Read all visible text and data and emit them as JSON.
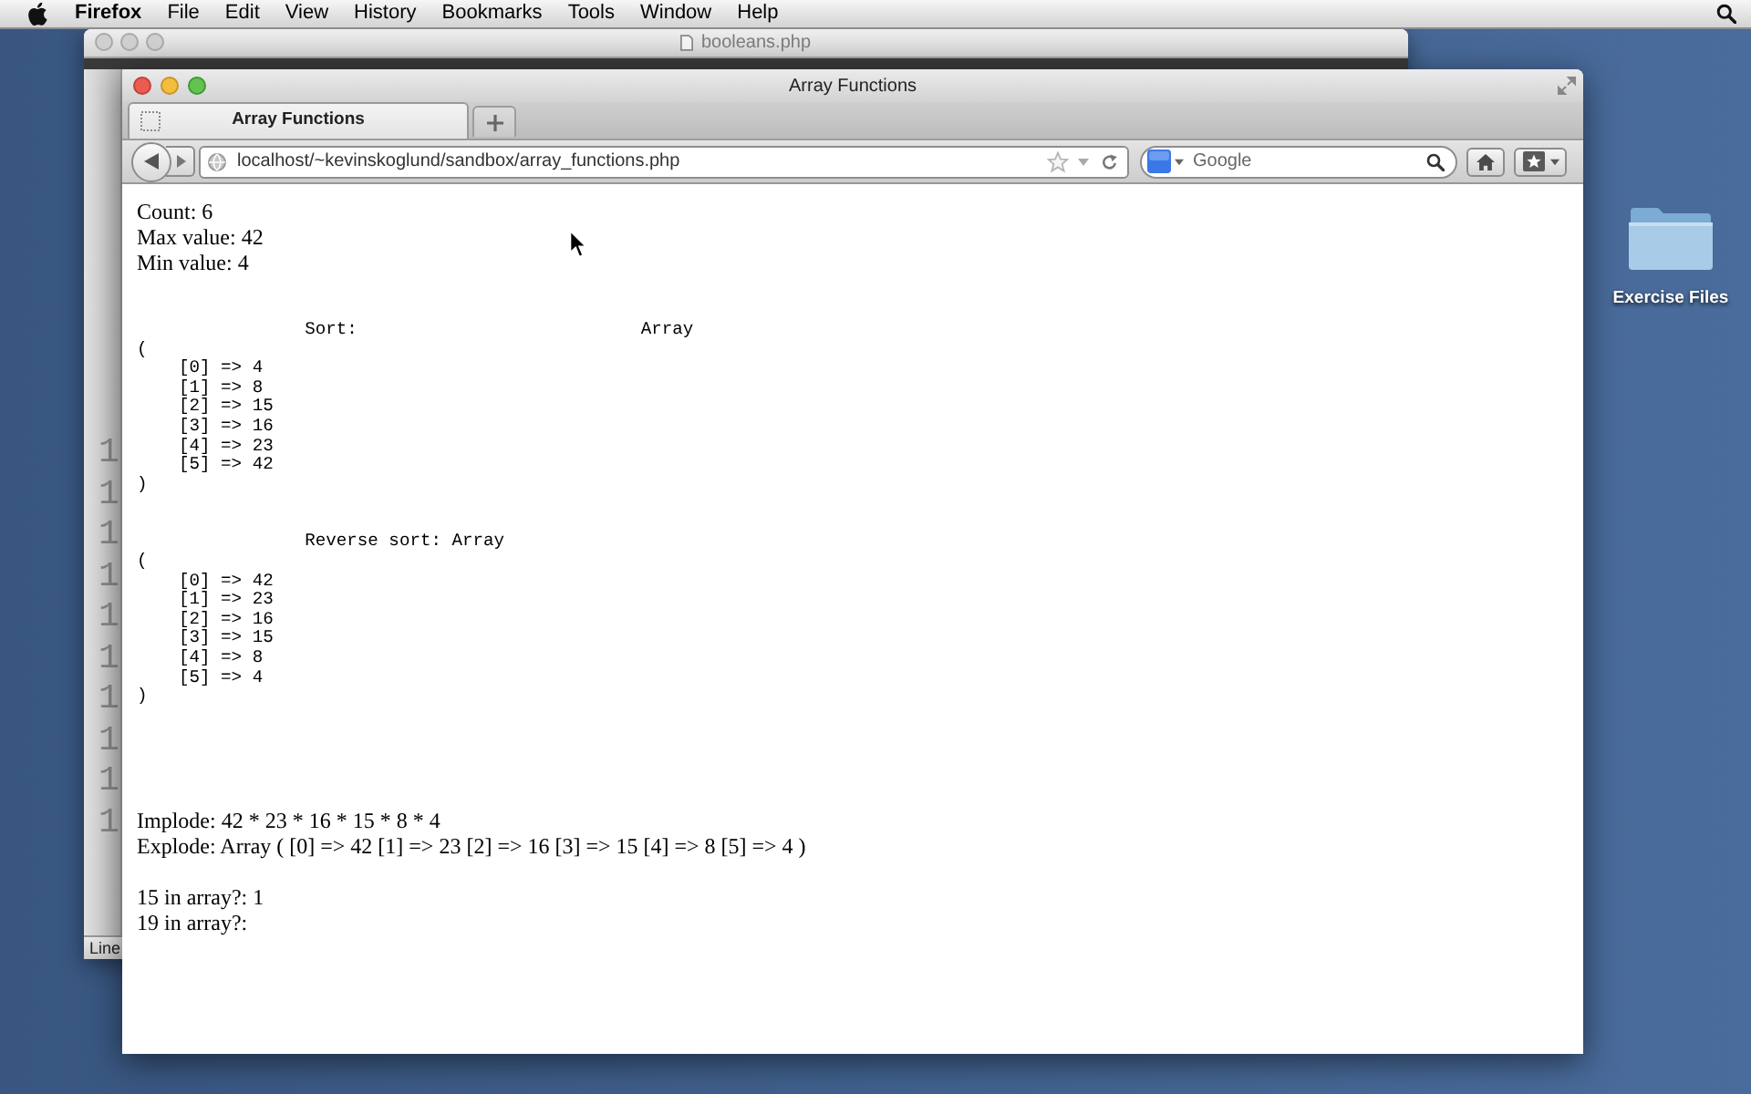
{
  "menu_bar": {
    "app_name": "Firefox",
    "menus": [
      "File",
      "Edit",
      "View",
      "History",
      "Bookmarks",
      "Tools",
      "Window",
      "Help"
    ]
  },
  "background_window": {
    "title": "booleans.php",
    "line_numbers": [
      "1",
      "1",
      "1",
      "1",
      "1",
      "1",
      "1",
      "1",
      "1",
      "1"
    ],
    "status_bar": "Line"
  },
  "browser_window": {
    "title": "Array Functions",
    "tabs": [
      {
        "label": "Array Functions",
        "selected": true
      }
    ],
    "address": "localhost/~kevinskoglund/sandbox/array_functions.php",
    "search": {
      "placeholder": "Google"
    }
  },
  "page": {
    "stats": [
      "Count: 6",
      "Max value: 42",
      "Min value: 4"
    ],
    "dumps": [
      {
        "kind": "tabbed",
        "label": "Sort:",
        "value": "Array",
        "open": "(",
        "entries": [
          "[0] => 4",
          "[1] => 8",
          "[2] => 15",
          "[3] => 16",
          "[4] => 23",
          "[5] => 42"
        ],
        "close": ")"
      },
      {
        "kind": "inline",
        "label": "Reverse sort:",
        "value": "Array",
        "open": "(",
        "entries": [
          "[0] => 42",
          "[1] => 23",
          "[2] => 16",
          "[3] => 15",
          "[4] => 8",
          "[5] => 4"
        ],
        "close": ")"
      }
    ],
    "string_results": [
      "Implode: 42 * 23 * 16 * 15 * 8 * 4",
      "Explode: Array ( [0] => 42 [1] => 23 [2] => 16 [3] => 15 [4] => 8 [5] => 4 )"
    ],
    "search_results": [
      "15 in array?: 1",
      "19 in array?:"
    ]
  },
  "desktop_icons": [
    {
      "label": "Exercise Files"
    }
  ]
}
